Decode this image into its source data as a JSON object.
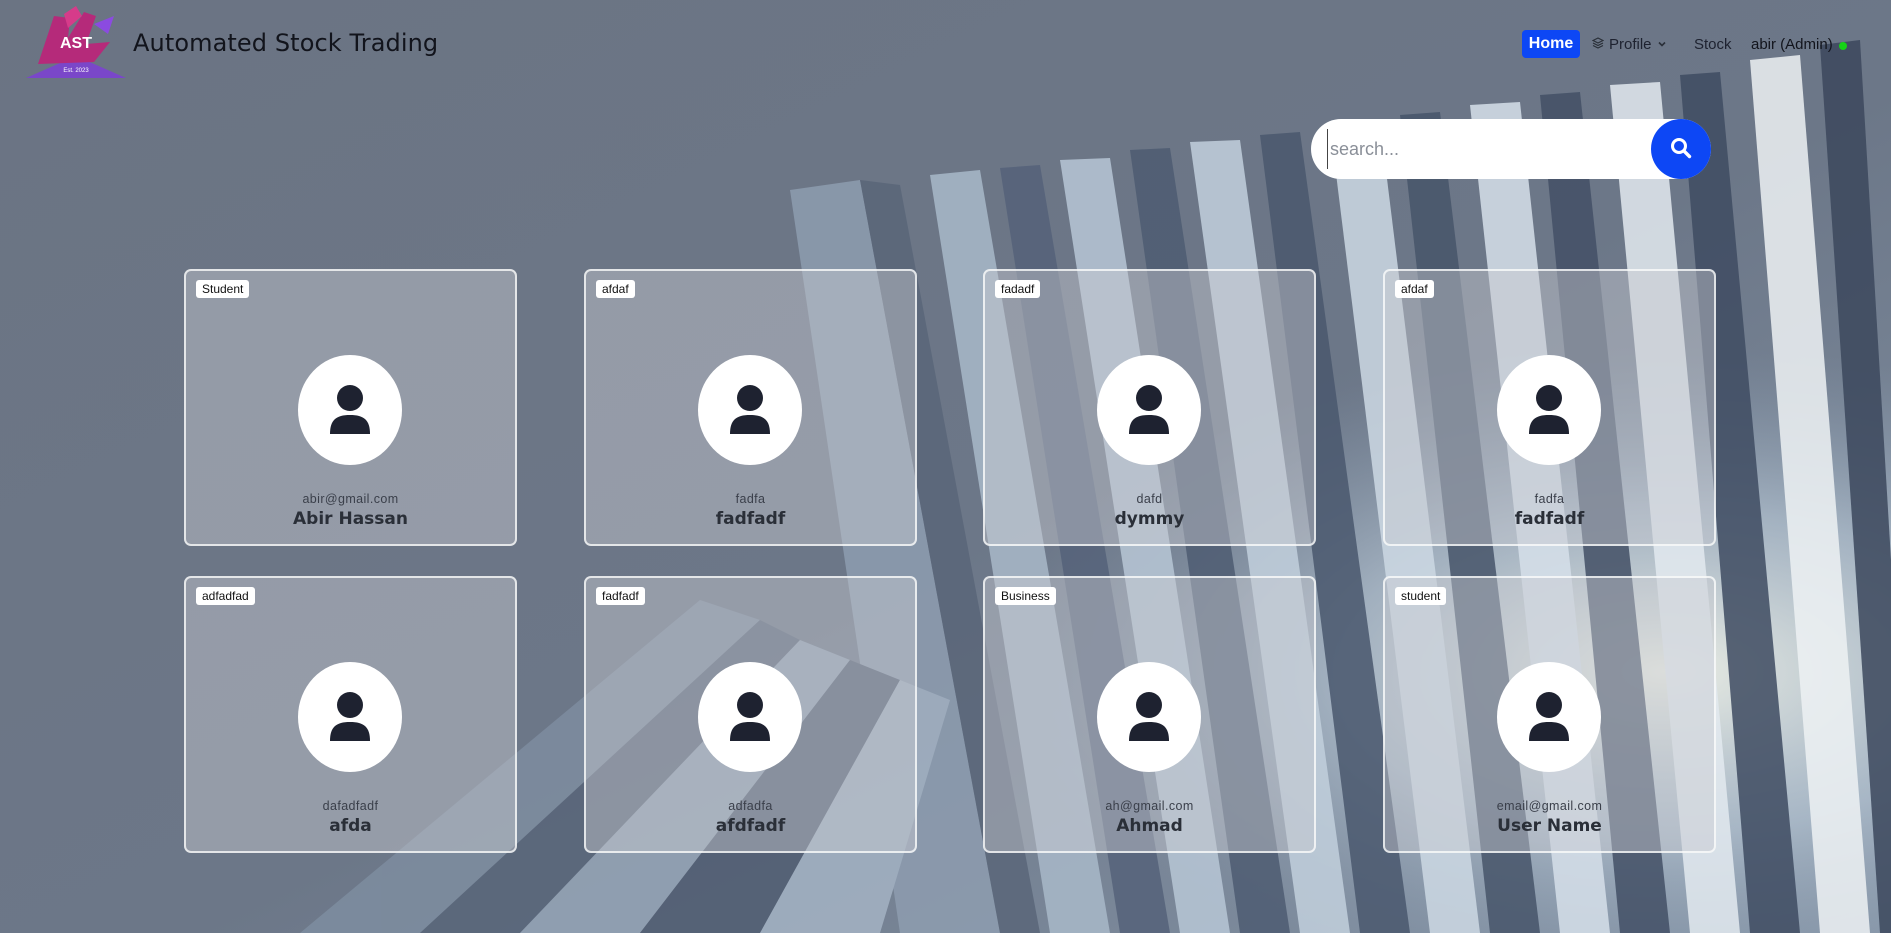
{
  "header": {
    "logo_text": "AST",
    "logo_tagline": "Est. 2023",
    "brand_title": "Automated Stock Trading",
    "nav": {
      "home": "Home",
      "profile": "Profile",
      "stock": "Stock",
      "user": "abir (Admin)"
    }
  },
  "search": {
    "placeholder": "search..."
  },
  "cards": [
    {
      "badge": "Student",
      "email": "abir@gmail.com",
      "name": "Abir Hassan"
    },
    {
      "badge": "afdaf",
      "email": "fadfa",
      "name": "fadfadf"
    },
    {
      "badge": "fadadf",
      "email": "dafd",
      "name": "dymmy"
    },
    {
      "badge": "afdaf",
      "email": "fadfa",
      "name": "fadfadf"
    },
    {
      "badge": "adfadfad",
      "email": "dafadfadf",
      "name": "afda"
    },
    {
      "badge": "fadfadf",
      "email": "adfadfa",
      "name": "afdfadf"
    },
    {
      "badge": "Business",
      "email": "ah@gmail.com",
      "name": "Ahmad"
    },
    {
      "badge": "student",
      "email": "email@gmail.com",
      "name": "User Name"
    }
  ],
  "colors": {
    "accent": "#0d47f5",
    "online": "#16d316",
    "background": "#667080"
  }
}
